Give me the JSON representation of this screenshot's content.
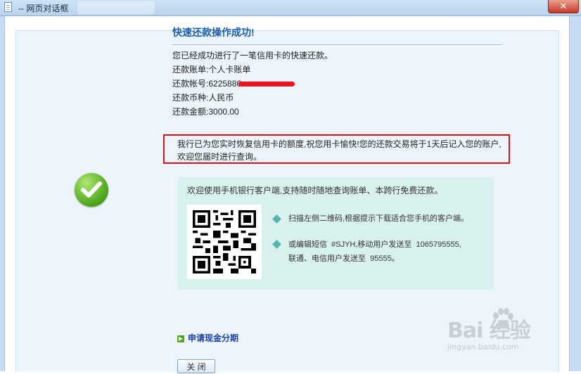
{
  "window": {
    "title": "-- 网页对话框",
    "close_glyph": "✕"
  },
  "result": {
    "heading": "快速还款操作成功!",
    "summary": "您已经成功进行了一笔信用卡的快速还款。",
    "bill_label": "还款账单:",
    "bill_value": "个人卡账单",
    "account_label": "还款帐号:",
    "account_value": "6225886",
    "currency_label": "还款币种:",
    "currency_value": "人民币",
    "amount_label": "还款金额:",
    "amount_value": "3000.00",
    "notice": "我行已为您实时恢复信用卡的额度,祝您用卡愉快!您的还款交易将于1天后记入您的账户,欢迎您届时进行查询。"
  },
  "mobile_app": {
    "title": "欢迎使用手机银行客户端,支持随时随地查询账单、本跨行免费还款。",
    "tip1": "扫描左侧二维码,根据提示下载适合您手机的客户端。",
    "tip2_line1": "或编辑短信  #SJYH,移动用户发送至  1065795555,",
    "tip2_line2": "联通、电信用户发送至  95555。"
  },
  "actions": {
    "installment_link": "申请现金分期",
    "close_button": "关 闭"
  },
  "watermark": {
    "brand": "Bai  经验",
    "url": "jingyan.baidu.com"
  },
  "colors": {
    "heading": "#1a5fa8",
    "notice_border": "#d4141c",
    "success": "#4aa318",
    "app_box": "#d8f0ee"
  }
}
